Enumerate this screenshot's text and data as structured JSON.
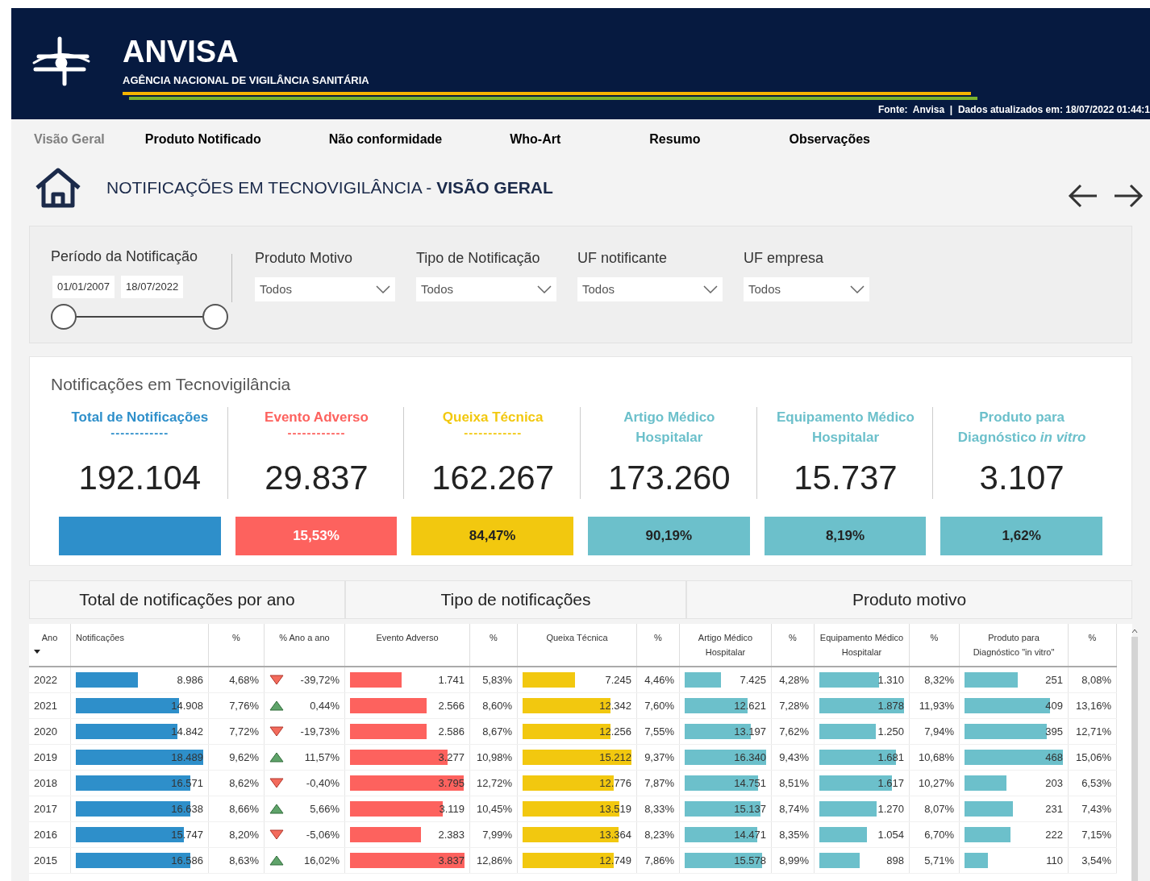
{
  "header": {
    "title": "ANVISA",
    "subtitle": "AGÊNCIA NACIONAL DE VIGILÂNCIA SANITÁRIA",
    "source": "Fonte:  Anvisa  |  Dados atualizados em: 18/07/2022 01:44:1"
  },
  "nav": [
    {
      "label": "Visão Geral",
      "selected": true
    },
    {
      "label": "Produto Notificado",
      "selected": false
    },
    {
      "label": "Não conformidade",
      "selected": false
    },
    {
      "label": "Who-Art",
      "selected": false
    },
    {
      "label": "Resumo",
      "selected": false
    },
    {
      "label": "Observações",
      "selected": false
    }
  ],
  "page_title": {
    "prefix": "NOTIFICAÇÕES EM TECNOVIGILÂNCIA - ",
    "bold": "VISÃO GERAL"
  },
  "filters": {
    "period": {
      "label": "Período da Notificação",
      "start": "01/01/2007",
      "end": "18/07/2022",
      "slider": {
        "start": {
          "level": 0
        },
        "end": {
          "level": 1
        }
      }
    },
    "dropdowns": [
      {
        "label": "Produto Motivo",
        "value": "Todos"
      },
      {
        "label": "Tipo de Notificação",
        "value": "Todos"
      },
      {
        "label": "UF notificante",
        "value": "Todos"
      },
      {
        "label": "UF empresa",
        "value": "Todos"
      }
    ]
  },
  "kpis": {
    "title": "Notificações em Tecnovigilância",
    "cards": [
      {
        "title": "Total de Notificações",
        "dashes": "------------",
        "value": "192.104",
        "color": "#2e8fca"
      },
      {
        "title": "Evento Adverso",
        "dashes": "------------",
        "value": "29.837",
        "bar_label": "15,53%",
        "color": "#fd625e"
      },
      {
        "title": "Queixa Técnica",
        "dashes": "------------",
        "value": "162.267",
        "bar_label": "84,47%",
        "color": "#f2c80f"
      },
      {
        "title": "Artigo Médico Hospitalar",
        "value": "173.260",
        "bar_label": "90,19%",
        "color": "#6cc0cb"
      },
      {
        "title": "Equipamento Médico Hospitalar",
        "value": "15.737",
        "bar_label": "8,19%",
        "color": "#6cc0cb"
      },
      {
        "title": "Produto para Diagnóstico *in vitro*",
        "value": "3.107",
        "bar_label": "1,62%",
        "color": "#6cc0cb"
      }
    ]
  },
  "sections": [
    "Total de notificações por ano",
    "Tipo de notificações",
    "Produto motivo"
  ],
  "table": {
    "columns": [
      {
        "label": "Ano",
        "sorted": true
      },
      {
        "label": "Notificações",
        "sorted": false,
        "color": "#2e8fca"
      },
      {
        "label": "%",
        "sorted": false
      },
      {
        "label": "% Ano a ano",
        "sorted": false
      },
      {
        "label": "Evento Adverso",
        "sorted": false,
        "color": "#fd625e"
      },
      {
        "label": "%",
        "sorted": false
      },
      {
        "label": "Queixa Técnica",
        "sorted": false,
        "color": "#f2c80f"
      },
      {
        "label": "%",
        "sorted": false
      },
      {
        "label": "Artigo Médico Hospitalar",
        "sorted": false,
        "color": "#6cc0cb"
      },
      {
        "label": "%",
        "sorted": false
      },
      {
        "label": "Equipamento Médico Hospitalar",
        "sorted": false,
        "color": "#6cc0cb"
      },
      {
        "label": "%",
        "sorted": false
      },
      {
        "label": "Produto para Diagnóstico \"in vitro\"",
        "sorted": false,
        "color": "#6cc0cb"
      },
      {
        "label": "%",
        "sorted": false
      }
    ],
    "rows": [
      {
        "year": "2022",
        "notif": {
          "text": "8.986",
          "level": 0.49
        },
        "pct": "4,68%",
        "up": false,
        "yoy": "-39,72%",
        "ea": {
          "text": "1.741",
          "level": 0.45
        },
        "ea_pct": "5,83%",
        "qt": {
          "text": "7.245",
          "level": 0.48
        },
        "qt_pct": "4,46%",
        "amh": {
          "text": "7.425",
          "level": 0.45
        },
        "amh_pct": "4,28%",
        "emh": {
          "text": "1.310",
          "level": 0.7
        },
        "emh_pct": "8,32%",
        "pdv": {
          "text": "251",
          "level": 0.54
        },
        "pdv_pct": "8,08%"
      },
      {
        "year": "2021",
        "notif": {
          "text": "14.908",
          "level": 0.81
        },
        "pct": "7,76%",
        "up": true,
        "yoy": "0,44%",
        "ea": {
          "text": "2.566",
          "level": 0.67
        },
        "ea_pct": "8,60%",
        "qt": {
          "text": "12.342",
          "level": 0.81
        },
        "qt_pct": "7,60%",
        "amh": {
          "text": "12.621",
          "level": 0.77
        },
        "amh_pct": "7,28%",
        "emh": {
          "text": "1.878",
          "level": 1
        },
        "emh_pct": "11,93%",
        "pdv": {
          "text": "409",
          "level": 0.87
        },
        "pdv_pct": "13,16%"
      },
      {
        "year": "2020",
        "notif": {
          "text": "14.842",
          "level": 0.8
        },
        "pct": "7,72%",
        "up": false,
        "yoy": "-19,73%",
        "ea": {
          "text": "2.586",
          "level": 0.67
        },
        "ea_pct": "8,67%",
        "qt": {
          "text": "12.256",
          "level": 0.81
        },
        "qt_pct": "7,55%",
        "amh": {
          "text": "13.197",
          "level": 0.81
        },
        "amh_pct": "7,62%",
        "emh": {
          "text": "1.250",
          "level": 0.67
        },
        "emh_pct": "7,94%",
        "pdv": {
          "text": "395",
          "level": 0.84
        },
        "pdv_pct": "12,71%"
      },
      {
        "year": "2019",
        "notif": {
          "text": "18.489",
          "level": 1
        },
        "pct": "9,62%",
        "up": true,
        "yoy": "11,57%",
        "ea": {
          "text": "3.277",
          "level": 0.85
        },
        "ea_pct": "10,98%",
        "qt": {
          "text": "15.212",
          "level": 1
        },
        "qt_pct": "9,37%",
        "amh": {
          "text": "16.340",
          "level": 1
        },
        "amh_pct": "9,43%",
        "emh": {
          "text": "1.681",
          "level": 0.9
        },
        "emh_pct": "10,68%",
        "pdv": {
          "text": "468",
          "level": 1
        },
        "pdv_pct": "15,06%"
      },
      {
        "year": "2018",
        "notif": {
          "text": "16.571",
          "level": 0.9
        },
        "pct": "8,62%",
        "up": false,
        "yoy": "-0,40%",
        "ea": {
          "text": "3.795",
          "level": 0.99
        },
        "ea_pct": "12,72%",
        "qt": {
          "text": "12.776",
          "level": 0.84
        },
        "qt_pct": "7,87%",
        "amh": {
          "text": "14.751",
          "level": 0.9
        },
        "amh_pct": "8,51%",
        "emh": {
          "text": "1.617",
          "level": 0.86
        },
        "emh_pct": "10,27%",
        "pdv": {
          "text": "203",
          "level": 0.43
        },
        "pdv_pct": "6,53%"
      },
      {
        "year": "2017",
        "notif": {
          "text": "16.638",
          "level": 0.9
        },
        "pct": "8,66%",
        "up": true,
        "yoy": "5,66%",
        "ea": {
          "text": "3.119",
          "level": 0.81
        },
        "ea_pct": "10,45%",
        "qt": {
          "text": "13.519",
          "level": 0.89
        },
        "qt_pct": "8,33%",
        "amh": {
          "text": "15.137",
          "level": 0.93
        },
        "amh_pct": "8,74%",
        "emh": {
          "text": "1.270",
          "level": 0.68
        },
        "emh_pct": "8,07%",
        "pdv": {
          "text": "231",
          "level": 0.49
        },
        "pdv_pct": "7,43%"
      },
      {
        "year": "2016",
        "notif": {
          "text": "15.747",
          "level": 0.85
        },
        "pct": "8,20%",
        "up": false,
        "yoy": "-5,06%",
        "ea": {
          "text": "2.383",
          "level": 0.62
        },
        "ea_pct": "7,99%",
        "qt": {
          "text": "13.364",
          "level": 0.88
        },
        "qt_pct": "8,23%",
        "amh": {
          "text": "14.471",
          "level": 0.89
        },
        "amh_pct": "8,35%",
        "emh": {
          "text": "1.054",
          "level": 0.56
        },
        "emh_pct": "6,70%",
        "pdv": {
          "text": "222",
          "level": 0.47
        },
        "pdv_pct": "7,15%"
      },
      {
        "year": "2015",
        "notif": {
          "text": "16.586",
          "level": 0.9
        },
        "pct": "8,63%",
        "up": true,
        "yoy": "16,02%",
        "ea": {
          "text": "3.837",
          "level": 1
        },
        "ea_pct": "12,86%",
        "qt": {
          "text": "12.749",
          "level": 0.84
        },
        "qt_pct": "7,86%",
        "amh": {
          "text": "15.578",
          "level": 0.95
        },
        "amh_pct": "8,99%",
        "emh": {
          "text": "898",
          "level": 0.48
        },
        "emh_pct": "5,71%",
        "pdv": {
          "text": "110",
          "level": 0.24
        },
        "pdv_pct": "3,54%"
      }
    ]
  }
}
